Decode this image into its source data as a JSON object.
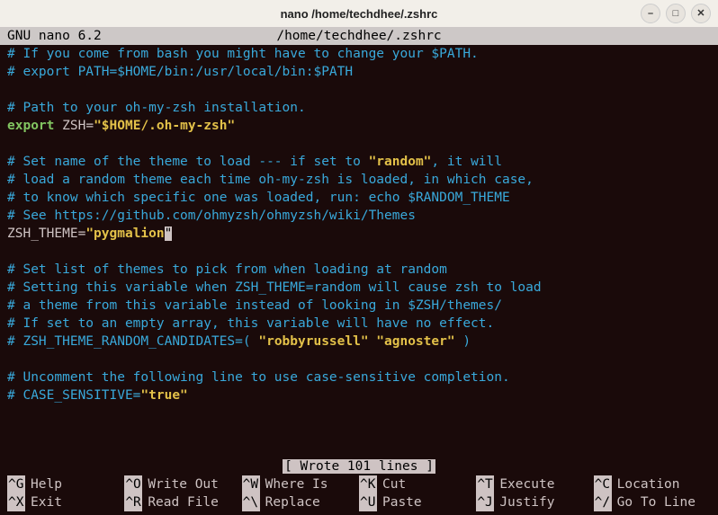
{
  "window": {
    "title": "nano /home/techdhee/.zshrc"
  },
  "header": {
    "app": "GNU nano 6.2",
    "filename": "/home/techdhee/.zshrc"
  },
  "content": {
    "l1": "# If you come from bash you might have to change your $PATH.",
    "l2": "# export PATH=$HOME/bin:/usr/local/bin:$PATH",
    "l4": "# Path to your oh-my-zsh installation.",
    "l5a": "export",
    "l5b": "ZSH",
    "l5eq": "=",
    "l5c": "\"$HOME/.oh-my-zsh\"",
    "l7a": "# Set name of the theme to load --- if set to ",
    "l7b": "\"random\"",
    "l7c": ", it will",
    "l8": "# load a random theme each time oh-my-zsh is loaded, in which case,",
    "l9": "# to know which specific one was loaded, run: echo $RANDOM_THEME",
    "l10": "# See https://github.com/ohmyzsh/ohmyzsh/wiki/Themes",
    "l11a": "ZSH_THEME",
    "l11eq": "=",
    "l11b": "\"pygmalion",
    "l11c": "\"",
    "l13": "# Set list of themes to pick from when loading at random",
    "l14": "# Setting this variable when ZSH_THEME=random will cause zsh to load",
    "l15": "# a theme from this variable instead of looking in $ZSH/themes/",
    "l16": "# If set to an empty array, this variable will have no effect.",
    "l17a": "# ZSH_THEME_RANDOM_CANDIDATES=( ",
    "l17b": "\"robbyrussell\" \"agnoster\"",
    "l17c": " )",
    "l19": "# Uncomment the following line to use case-sensitive completion.",
    "l20a": "# CASE_SENSITIVE=",
    "l20b": "\"true\""
  },
  "status": "[ Wrote 101 lines ]",
  "shortcuts": {
    "r1c1k": "^G",
    "r1c1l": "Help",
    "r1c2k": "^O",
    "r1c2l": "Write Out",
    "r1c3k": "^W",
    "r1c3l": "Where Is",
    "r1c4k": "^K",
    "r1c4l": "Cut",
    "r1c5k": "^T",
    "r1c5l": "Execute",
    "r1c6k": "^C",
    "r1c6l": "Location",
    "r2c1k": "^X",
    "r2c1l": "Exit",
    "r2c2k": "^R",
    "r2c2l": "Read File",
    "r2c3k": "^\\",
    "r2c3l": "Replace",
    "r2c4k": "^U",
    "r2c4l": "Paste",
    "r2c5k": "^J",
    "r2c5l": "Justify",
    "r2c6k": "^/",
    "r2c6l": "Go To Line"
  }
}
